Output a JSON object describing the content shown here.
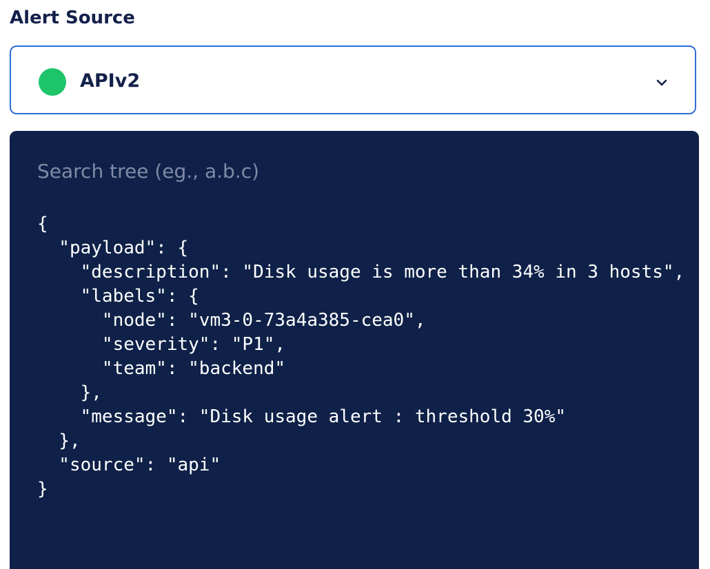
{
  "section": {
    "label": "Alert Source"
  },
  "source_select": {
    "selected": "APIv2",
    "status_color": "#1ec46a",
    "chevron_icon": "chevron-down-icon"
  },
  "tree_search": {
    "placeholder": "Search tree (eg., a.b.c)",
    "value": ""
  },
  "json_tree": {
    "lines": [
      "{",
      "  \"payload\": {",
      "    \"description\": \"Disk usage is more than 34% in 3 hosts\",",
      "    \"labels\": {",
      "      \"node\": \"vm3-0-73a4a385-cea0\",",
      "      \"severity\": \"P1\",",
      "      \"team\": \"backend\"",
      "    },",
      "    \"message\": \"Disk usage alert : threshold 30%\"",
      "  },",
      "  \"source\": \"api\"",
      "}"
    ]
  },
  "colors": {
    "heading_text": "#13204a",
    "select_border": "#2e6fd8",
    "tree_background": "#0f2148",
    "tree_text": "#ffffff",
    "placeholder_text": "#7f8aa6"
  }
}
